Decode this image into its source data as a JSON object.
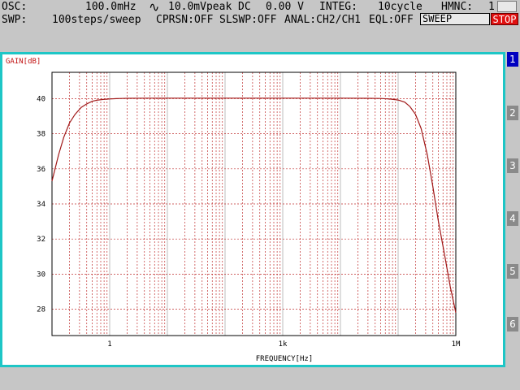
{
  "status_bar": {
    "osc_label": "OSC:",
    "osc_freq": "100.0mHz",
    "osc_wave_icon": "sine-wave-icon",
    "osc_amp": "10.0mVpeak",
    "dc_label": "DC",
    "dc_value": "0.00 V",
    "integ_label": "INTEG:",
    "integ_value": "10cycle",
    "hmnc_label": "HMNC:",
    "hmnc_value": "1",
    "swp_label": "SWP:",
    "swp_value": "100steps/sweep",
    "cprsn": "CPRSN:OFF",
    "slswp": "SLSWP:OFF",
    "anal": "ANAL:CH2/CH1",
    "eql": "EQL:OFF",
    "sweep_button": "SWEEP",
    "stop_button": "STOP"
  },
  "colors": {
    "background": "#c6c6c6",
    "panel_border": "#1ec6c6",
    "trace": "#a01818",
    "grid": "#c03030",
    "stop": "#e01010",
    "active_tab": "#0000c0"
  },
  "chart_data": {
    "type": "line",
    "ylabel": "GAIN[dB]",
    "xlabel": "FREQUENCY[Hz]",
    "x_scale": "log",
    "xlim": [
      0.1,
      1000000
    ],
    "ylim": [
      26.5,
      41.5
    ],
    "x_tick_labels": [
      {
        "x": 1,
        "label": "1"
      },
      {
        "x": 1000,
        "label": "1k"
      },
      {
        "x": 1000000,
        "label": "1M"
      }
    ],
    "y_ticks": [
      28,
      30,
      32,
      34,
      36,
      38,
      40
    ],
    "grid": true,
    "series": [
      {
        "x": [
          0.1,
          0.13,
          0.16,
          0.2,
          0.25,
          0.32,
          0.4,
          0.5,
          0.63,
          0.8,
          1,
          1.3,
          1.6,
          2,
          5,
          10,
          100,
          1000,
          10000,
          30000,
          50000,
          70000,
          100000,
          130000,
          160000,
          200000,
          250000,
          320000,
          400000,
          500000,
          630000,
          800000,
          1000000
        ],
        "y": [
          35.3,
          36.8,
          37.8,
          38.6,
          39.1,
          39.5,
          39.7,
          39.85,
          39.92,
          39.96,
          39.98,
          40.0,
          40.01,
          40.02,
          40.03,
          40.03,
          40.03,
          40.03,
          40.03,
          40.02,
          40.01,
          39.98,
          39.92,
          39.8,
          39.55,
          39.1,
          38.3,
          36.8,
          35.0,
          33.0,
          31.2,
          29.3,
          27.8
        ]
      }
    ]
  },
  "side_tabs": [
    "1",
    "2",
    "3",
    "4",
    "5",
    "6"
  ]
}
